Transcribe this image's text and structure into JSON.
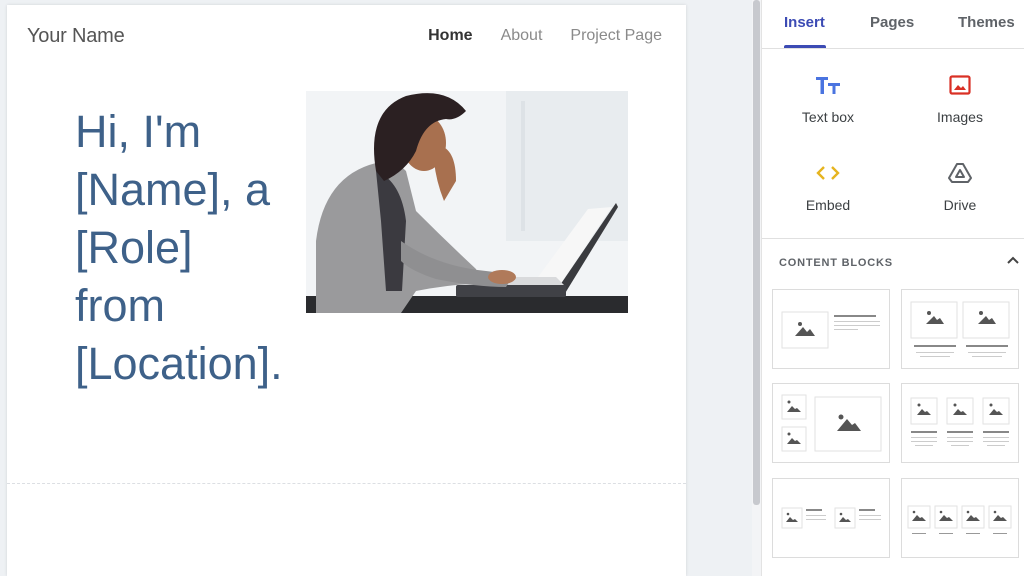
{
  "site": {
    "title": "Your Name",
    "nav": [
      {
        "label": "Home",
        "active": true
      },
      {
        "label": "About",
        "active": false
      },
      {
        "label": "Project Page",
        "active": false
      }
    ],
    "hero_text": "Hi, I'm [Name], a [Role] from [Location].",
    "hero_image_alt": "Woman smiling while typing on a laptop"
  },
  "panel": {
    "tabs": [
      {
        "label": "Insert",
        "active": true
      },
      {
        "label": "Pages",
        "active": false
      },
      {
        "label": "Themes",
        "active": false
      }
    ],
    "insert_items": [
      {
        "label": "Text box",
        "icon": "text-box-icon",
        "color": "#4a74e0"
      },
      {
        "label": "Images",
        "icon": "image-icon",
        "color": "#d93025"
      },
      {
        "label": "Embed",
        "icon": "embed-code-icon",
        "color": "#e6b41f"
      },
      {
        "label": "Drive",
        "icon": "drive-icon",
        "color": "#5f6368"
      }
    ],
    "content_blocks": {
      "header": "CONTENT BLOCKS",
      "collapse_icon": "chevron-up-icon",
      "layouts": [
        "image-left-text-right",
        "two-images-with-text",
        "two-small-one-large-image",
        "three-images-with-text",
        "two-images-inline-text",
        "four-images-with-captions"
      ]
    }
  },
  "colors": {
    "accent": "#3c4bb4",
    "hero_text": "#3e6189"
  }
}
